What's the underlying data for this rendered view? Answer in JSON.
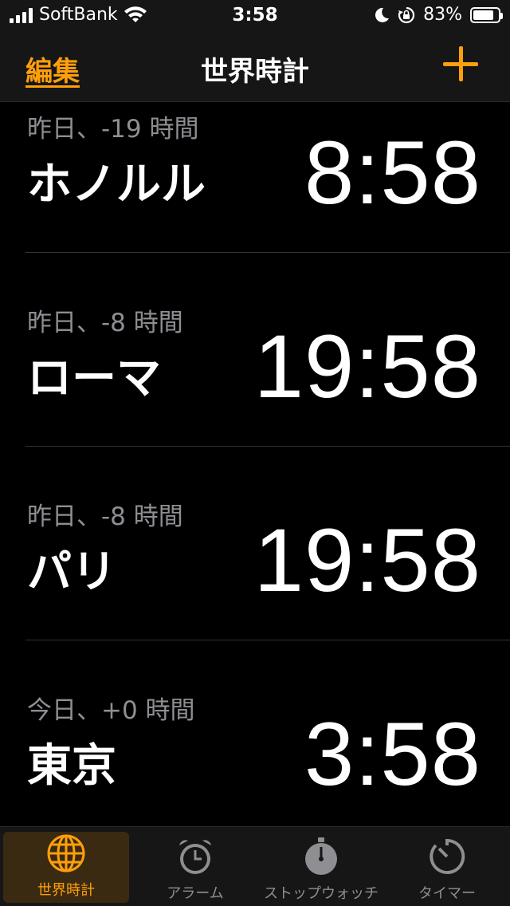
{
  "status_bar": {
    "carrier": "SoftBank",
    "time": "3:58",
    "battery_percent": "83%",
    "battery_level": 0.83,
    "icons": [
      "cellular-signal-icon",
      "wifi-icon",
      "moon-icon",
      "orientation-lock-icon",
      "battery-icon"
    ]
  },
  "nav": {
    "edit_label": "編集",
    "title": "世界時計",
    "add_icon": "plus-icon"
  },
  "clocks": [
    {
      "offset": "昨日、-19 時間",
      "city": "ホノルル",
      "time": "8:58"
    },
    {
      "offset": "昨日、-8 時間",
      "city": "ローマ",
      "time": "19:58"
    },
    {
      "offset": "昨日、-8 時間",
      "city": "パリ",
      "time": "19:58"
    },
    {
      "offset": "今日、+0 時間",
      "city": "東京",
      "time": "3:58"
    }
  ],
  "tabs": [
    {
      "label": "世界時計",
      "icon": "globe-icon",
      "active": true
    },
    {
      "label": "アラーム",
      "icon": "alarm-clock-icon",
      "active": false
    },
    {
      "label": "ストップウォッチ",
      "icon": "stopwatch-icon",
      "active": false
    },
    {
      "label": "タイマー",
      "icon": "timer-icon",
      "active": false
    }
  ],
  "colors": {
    "accent": "#ff9f0a",
    "background": "#000000",
    "bar_background": "#161616",
    "secondary_text": "#8e8e93"
  }
}
